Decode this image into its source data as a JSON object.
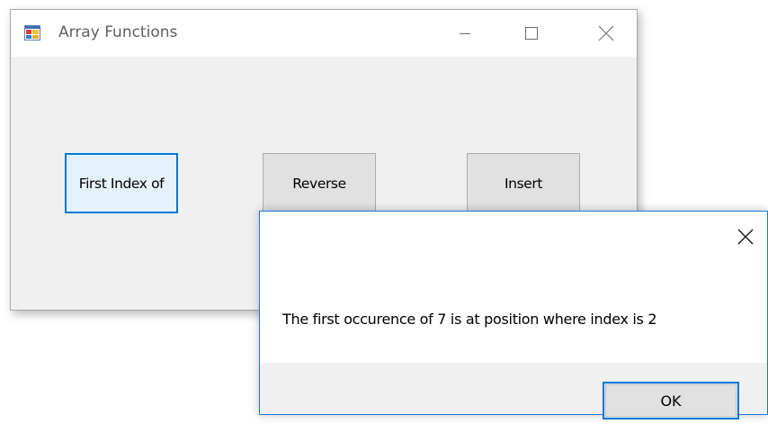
{
  "main_window": {
    "title": "Array Functions",
    "icon": "windows-forms-app-icon",
    "caption_buttons": {
      "minimize": "minimize-icon",
      "maximize": "maximize-icon",
      "close": "close-icon"
    },
    "buttons": {
      "first_index_of": "First Index of",
      "reverse": "Reverse",
      "insert": "Insert"
    }
  },
  "message_box": {
    "message": "The first occurence of 7 is at position where index is 2",
    "ok_label": "OK",
    "close_icon": "close-icon"
  },
  "colors": {
    "focus_blue": "#0078d7",
    "button_face": "#e1e1e1",
    "form_background": "#f0f0f0",
    "message_box_border": "#1a7ad4"
  }
}
